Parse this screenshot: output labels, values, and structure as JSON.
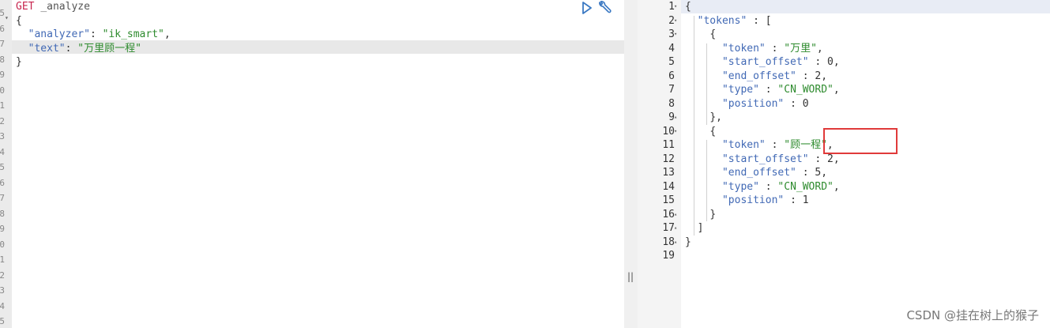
{
  "request": {
    "method": "GET",
    "endpoint": "_analyze",
    "lines": [
      {
        "t": "{"
      },
      {
        "k": "\"analyzer\"",
        "s": "\"ik_smart\"",
        "c": ","
      },
      {
        "k": "\"text\"",
        "s": "\"万里顾一程\"",
        "c": ""
      },
      {
        "t": "}"
      }
    ],
    "left_gutter_digits": [
      "5",
      "6",
      "7",
      "8",
      "9",
      "0",
      "1",
      "2",
      "3",
      "4",
      "5",
      "6",
      "7",
      "8",
      "9",
      "0",
      "1",
      "2",
      "3",
      "4",
      "5"
    ]
  },
  "toolbar": {
    "run_title": "Run",
    "settings_title": "Settings"
  },
  "divider": {
    "handle": "||"
  },
  "response": {
    "line_numbers": [
      "1",
      "2",
      "3",
      "4",
      "5",
      "6",
      "7",
      "8",
      "9",
      "10",
      "11",
      "12",
      "13",
      "14",
      "15",
      "16",
      "17",
      "18",
      "19"
    ],
    "lines": [
      "{",
      "  \"tokens\" : [",
      "    {",
      "      \"token\" : \"万里\",",
      "      \"start_offset\" : 0,",
      "      \"end_offset\" : 2,",
      "      \"type\" : \"CN_WORD\",",
      "      \"position\" : 0",
      "    },",
      "    {",
      "      \"token\" : \"顾一程\",",
      "      \"start_offset\" : 2,",
      "      \"end_offset\" : 5,",
      "      \"type\" : \"CN_WORD\",",
      "      \"position\" : 1",
      "    }",
      "  ]",
      "}",
      ""
    ]
  },
  "watermark": "CSDN @挂在树上的猴子"
}
